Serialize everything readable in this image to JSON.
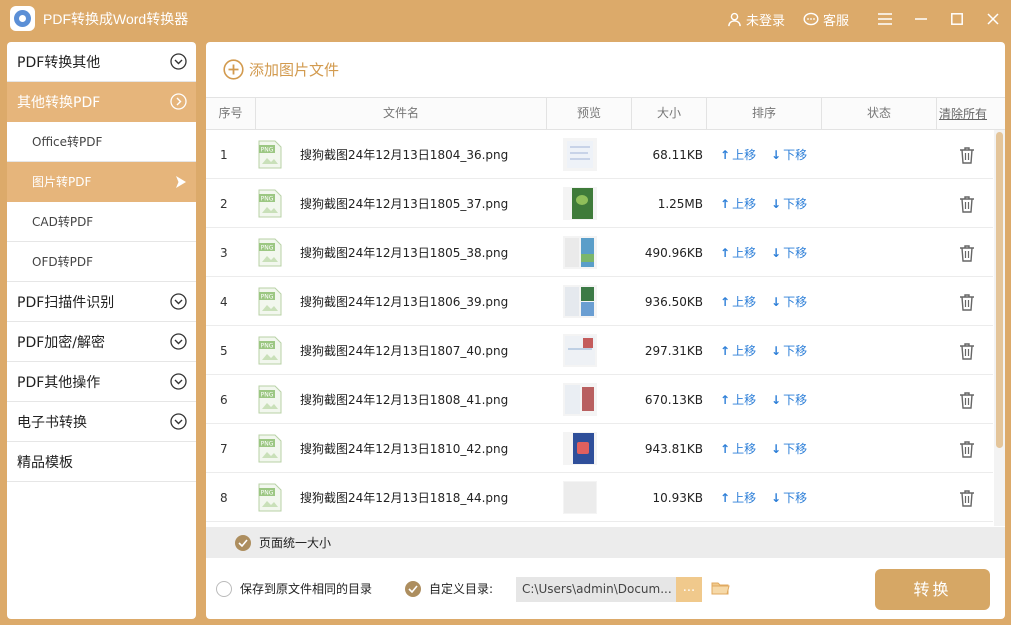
{
  "app": {
    "title": "PDF转换成Word转换器"
  },
  "titlebar": {
    "login_label": "未登录",
    "service_label": "客服"
  },
  "sidebar": {
    "items": [
      {
        "label": "PDF转换其他",
        "active": false,
        "sub": []
      },
      {
        "label": "其他转换PDF",
        "active": true,
        "sub": [
          {
            "label": "Office转PDF",
            "active": false
          },
          {
            "label": "图片转PDF",
            "active": true
          },
          {
            "label": "CAD转PDF",
            "active": false
          },
          {
            "label": "OFD转PDF",
            "active": false
          }
        ]
      },
      {
        "label": "PDF扫描件识别",
        "active": false,
        "sub": []
      },
      {
        "label": "PDF加密/解密",
        "active": false,
        "sub": []
      },
      {
        "label": "PDF其他操作",
        "active": false,
        "sub": []
      },
      {
        "label": "电子书转换",
        "active": false,
        "sub": []
      },
      {
        "label": "精品模板",
        "active": false,
        "sub": []
      }
    ]
  },
  "main": {
    "add_file_label": "添加图片文件",
    "columns": {
      "no": "序号",
      "name": "文件名",
      "preview": "预览",
      "size": "大小",
      "sort": "排序",
      "status": "状态",
      "clear_all": "清除所有"
    },
    "move_up_label": "上移",
    "move_down_label": "下移",
    "file_icon_text": "PNG",
    "rows": [
      {
        "no": "1",
        "name": "搜狗截图24年12月13日1804_36.png",
        "size": "68.11KB"
      },
      {
        "no": "2",
        "name": "搜狗截图24年12月13日1805_37.png",
        "size": "1.25MB"
      },
      {
        "no": "3",
        "name": "搜狗截图24年12月13日1805_38.png",
        "size": "490.96KB"
      },
      {
        "no": "4",
        "name": "搜狗截图24年12月13日1806_39.png",
        "size": "936.50KB"
      },
      {
        "no": "5",
        "name": "搜狗截图24年12月13日1807_40.png",
        "size": "297.31KB"
      },
      {
        "no": "6",
        "name": "搜狗截图24年12月13日1808_41.png",
        "size": "670.13KB"
      },
      {
        "no": "7",
        "name": "搜狗截图24年12月13日1810_42.png",
        "size": "943.81KB"
      },
      {
        "no": "8",
        "name": "搜狗截图24年12月13日1818_44.png",
        "size": "10.93KB"
      }
    ],
    "uniform_size_label": "页面统一大小",
    "save_same_dir_label": "保存到原文件相同的目录",
    "custom_dir_label": "自定义目录:",
    "custom_dir_path": "C:\\Users\\admin\\Docum...",
    "browse_label": "...",
    "convert_label": "转换"
  },
  "colors": {
    "brand": "#dcaa6a",
    "active_nav": "#e6b57b",
    "link": "#2d7fd8",
    "accent_text": "#d29a4e"
  }
}
